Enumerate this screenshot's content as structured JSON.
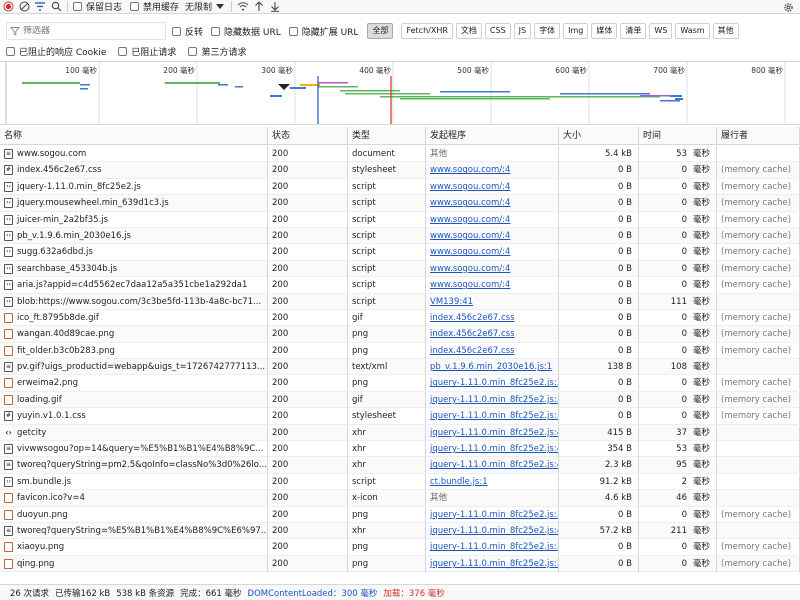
{
  "toolbar": {
    "preserve_log": "保留日志",
    "disable_cache": "禁用缓存",
    "throttle": "无限制"
  },
  "filter": {
    "placeholder": "筛选器",
    "invert": "反转",
    "hide_data_urls": "隐藏数据 URL",
    "hide_extension_urls": "隐藏扩展 URL",
    "types": [
      "全部",
      "Fetch/XHR",
      "文档",
      "CSS",
      "JS",
      "字体",
      "Img",
      "媒体",
      "清单",
      "WS",
      "Wasm",
      "其他"
    ],
    "blocked_cookies": "已阻止的响应 Cookie",
    "blocked_requests": "已阻止请求",
    "third_party": "第三方请求"
  },
  "overview": {
    "ticks": [
      "100 毫秒",
      "200 毫秒",
      "300 毫秒",
      "400 毫秒",
      "500 毫秒",
      "600 毫秒",
      "700 毫秒",
      "800 毫秒"
    ]
  },
  "table": {
    "headers": [
      "名称",
      "状态",
      "类型",
      "发起程序",
      "大小",
      "时间",
      "履行者"
    ],
    "rows": [
      {
        "icon": "document-icon",
        "name": "www.sogou.com",
        "status": "200",
        "type": "document",
        "initiator": "其他",
        "link": false,
        "size": "5.4 kB",
        "time": "53",
        "unit": "毫秒",
        "rank": ""
      },
      {
        "icon": "stylesheet-icon",
        "name": "index.456c2e67.css",
        "status": "200",
        "type": "stylesheet",
        "initiator": "www.sogou.com/:4",
        "link": true,
        "size": "0 B",
        "time": "0",
        "unit": "毫秒",
        "rank": "(memory cache)"
      },
      {
        "icon": "script-icon",
        "name": "jquery-1.11.0.min_8fc25e2.js",
        "status": "200",
        "type": "script",
        "initiator": "www.sogou.com/:4",
        "link": true,
        "size": "0 B",
        "time": "0",
        "unit": "毫秒",
        "rank": "(memory cache)"
      },
      {
        "icon": "script-icon",
        "name": "jquery.mousewheel.min_639d1c3.js",
        "status": "200",
        "type": "script",
        "initiator": "www.sogou.com/:4",
        "link": true,
        "size": "0 B",
        "time": "0",
        "unit": "毫秒",
        "rank": "(memory cache)"
      },
      {
        "icon": "script-icon",
        "name": "juicer-min_2a2bf35.js",
        "status": "200",
        "type": "script",
        "initiator": "www.sogou.com/:4",
        "link": true,
        "size": "0 B",
        "time": "0",
        "unit": "毫秒",
        "rank": "(memory cache)"
      },
      {
        "icon": "script-icon",
        "name": "pb_v.1.9.6.min_2030e16.js",
        "status": "200",
        "type": "script",
        "initiator": "www.sogou.com/:4",
        "link": true,
        "size": "0 B",
        "time": "0",
        "unit": "毫秒",
        "rank": "(memory cache)"
      },
      {
        "icon": "script-icon",
        "name": "sugg.632a6dbd.js",
        "status": "200",
        "type": "script",
        "initiator": "www.sogou.com/:4",
        "link": true,
        "size": "0 B",
        "time": "0",
        "unit": "毫秒",
        "rank": "(memory cache)"
      },
      {
        "icon": "script-icon",
        "name": "searchbase_453304b.js",
        "status": "200",
        "type": "script",
        "initiator": "www.sogou.com/:4",
        "link": true,
        "size": "0 B",
        "time": "0",
        "unit": "毫秒",
        "rank": "(memory cache)"
      },
      {
        "icon": "script-icon",
        "name": "aria.js?appid=c4d5562ec7daa12a5a351cbe1a292da1",
        "status": "200",
        "type": "script",
        "initiator": "www.sogou.com/:4",
        "link": true,
        "size": "0 B",
        "time": "0",
        "unit": "毫秒",
        "rank": "(memory cache)"
      },
      {
        "icon": "script-icon",
        "name": "blob:https://www.sogou.com/3c3be5fd-113b-4a8c-bc71...",
        "status": "200",
        "type": "script",
        "initiator": "VM139:41",
        "link": true,
        "size": "0 B",
        "time": "111",
        "unit": "毫秒",
        "rank": ""
      },
      {
        "icon": "image-icon",
        "name": "ico_ft.8795b8de.gif",
        "status": "200",
        "type": "gif",
        "initiator": "index.456c2e67.css",
        "link": true,
        "size": "0 B",
        "time": "0",
        "unit": "毫秒",
        "rank": "(memory cache)"
      },
      {
        "icon": "image-icon",
        "name": "wangan.40d89cae.png",
        "status": "200",
        "type": "png",
        "initiator": "index.456c2e67.css",
        "link": true,
        "size": "0 B",
        "time": "0",
        "unit": "毫秒",
        "rank": "(memory cache)"
      },
      {
        "icon": "image-icon",
        "name": "fit_older.b3c0b283.png",
        "status": "200",
        "type": "png",
        "initiator": "index.456c2e67.css",
        "link": true,
        "size": "0 B",
        "time": "0",
        "unit": "毫秒",
        "rank": "(memory cache)"
      },
      {
        "icon": "document-icon",
        "name": "pv.gif?uigs_productid=webapp&uigs_t=1726742777113...",
        "status": "200",
        "type": "text/xml",
        "initiator": "pb_v.1.9.6.min_2030e16.js:1",
        "link": true,
        "size": "138 B",
        "time": "108",
        "unit": "毫秒",
        "rank": ""
      },
      {
        "icon": "image-icon",
        "name": "erweima2.png",
        "status": "200",
        "type": "png",
        "initiator": "jquery-1.11.0.min_8fc25e2.js:3",
        "link": true,
        "size": "0 B",
        "time": "0",
        "unit": "毫秒",
        "rank": "(memory cache)"
      },
      {
        "icon": "image-icon",
        "name": "loading.gif",
        "status": "200",
        "type": "gif",
        "initiator": "jquery-1.11.0.min_8fc25e2.js:3",
        "link": true,
        "size": "0 B",
        "time": "0",
        "unit": "毫秒",
        "rank": "(memory cache)"
      },
      {
        "icon": "stylesheet-icon",
        "name": "yuyin.v1.0.1.css",
        "status": "200",
        "type": "stylesheet",
        "initiator": "jquery-1.11.0.min_8fc25e2.js:3",
        "link": true,
        "size": "0 B",
        "time": "0",
        "unit": "毫秒",
        "rank": "(memory cache)"
      },
      {
        "icon": "xhr-icon",
        "name": "getcity",
        "status": "200",
        "type": "xhr",
        "initiator": "jquery-1.11.0.min_8fc25e2.js:4",
        "link": true,
        "size": "415 B",
        "time": "37",
        "unit": "毫秒",
        "rank": ""
      },
      {
        "icon": "document-icon",
        "name": "vivwwsogou?op=14&query=%E5%B1%B1%E4%B8%9C...",
        "status": "200",
        "type": "xhr",
        "initiator": "jquery-1.11.0.min_8fc25e2.js:4",
        "link": true,
        "size": "354 B",
        "time": "53",
        "unit": "毫秒",
        "rank": ""
      },
      {
        "icon": "document-icon",
        "name": "tworeq?queryString=pm2.5&qoInfo=classNo%3d0%26lo...",
        "status": "200",
        "type": "xhr",
        "initiator": "jquery-1.11.0.min_8fc25e2.js:4",
        "link": true,
        "size": "2.3 kB",
        "time": "95",
        "unit": "毫秒",
        "rank": ""
      },
      {
        "icon": "script-icon",
        "name": "sm.bundle.js",
        "status": "200",
        "type": "script",
        "initiator": "ct.bundle.js:1",
        "link": true,
        "size": "91.2 kB",
        "time": "2",
        "unit": "毫秒",
        "rank": ""
      },
      {
        "icon": "image-icon",
        "name": "favicon.ico?v=4",
        "status": "200",
        "type": "x-icon",
        "initiator": "其他",
        "link": false,
        "size": "4.6 kB",
        "time": "46",
        "unit": "毫秒",
        "rank": ""
      },
      {
        "icon": "image-icon",
        "name": "duoyun.png",
        "status": "200",
        "type": "png",
        "initiator": "jquery-1.11.0.min_8fc25e2.js:3",
        "link": true,
        "size": "0 B",
        "time": "0",
        "unit": "毫秒",
        "rank": "(memory cache)"
      },
      {
        "icon": "document-icon",
        "name": "tworeq?queryString=%E5%B1%B1%E4%B8%9C%E6%97...",
        "status": "200",
        "type": "xhr",
        "initiator": "jquery-1.11.0.min_8fc25e2.js:4",
        "link": true,
        "size": "57.2 kB",
        "time": "211",
        "unit": "毫秒",
        "rank": ""
      },
      {
        "icon": "image-icon",
        "name": "xiaoyu.png",
        "status": "200",
        "type": "png",
        "initiator": "jquery-1.11.0.min_8fc25e2.js:3",
        "link": true,
        "size": "0 B",
        "time": "0",
        "unit": "毫秒",
        "rank": "(memory cache)"
      },
      {
        "icon": "image-icon",
        "name": "qing.png",
        "status": "200",
        "type": "png",
        "initiator": "jquery-1.11.0.min_8fc25e2.js:3",
        "link": true,
        "size": "0 B",
        "time": "0",
        "unit": "毫秒",
        "rank": "(memory cache)"
      }
    ]
  },
  "statusbar": {
    "requests": "26 次请求",
    "transferred": "已传输162 kB",
    "resources": "538 kB 条资源",
    "finish": "完成：661 毫秒",
    "dcl": "DOMContentLoaded：300 毫秒",
    "load": "加载：376 毫秒"
  },
  "colors": {
    "link": "#1a56c4",
    "dcl_line": "#1a56c4",
    "load_line": "#d23030",
    "record": "#d23030"
  }
}
